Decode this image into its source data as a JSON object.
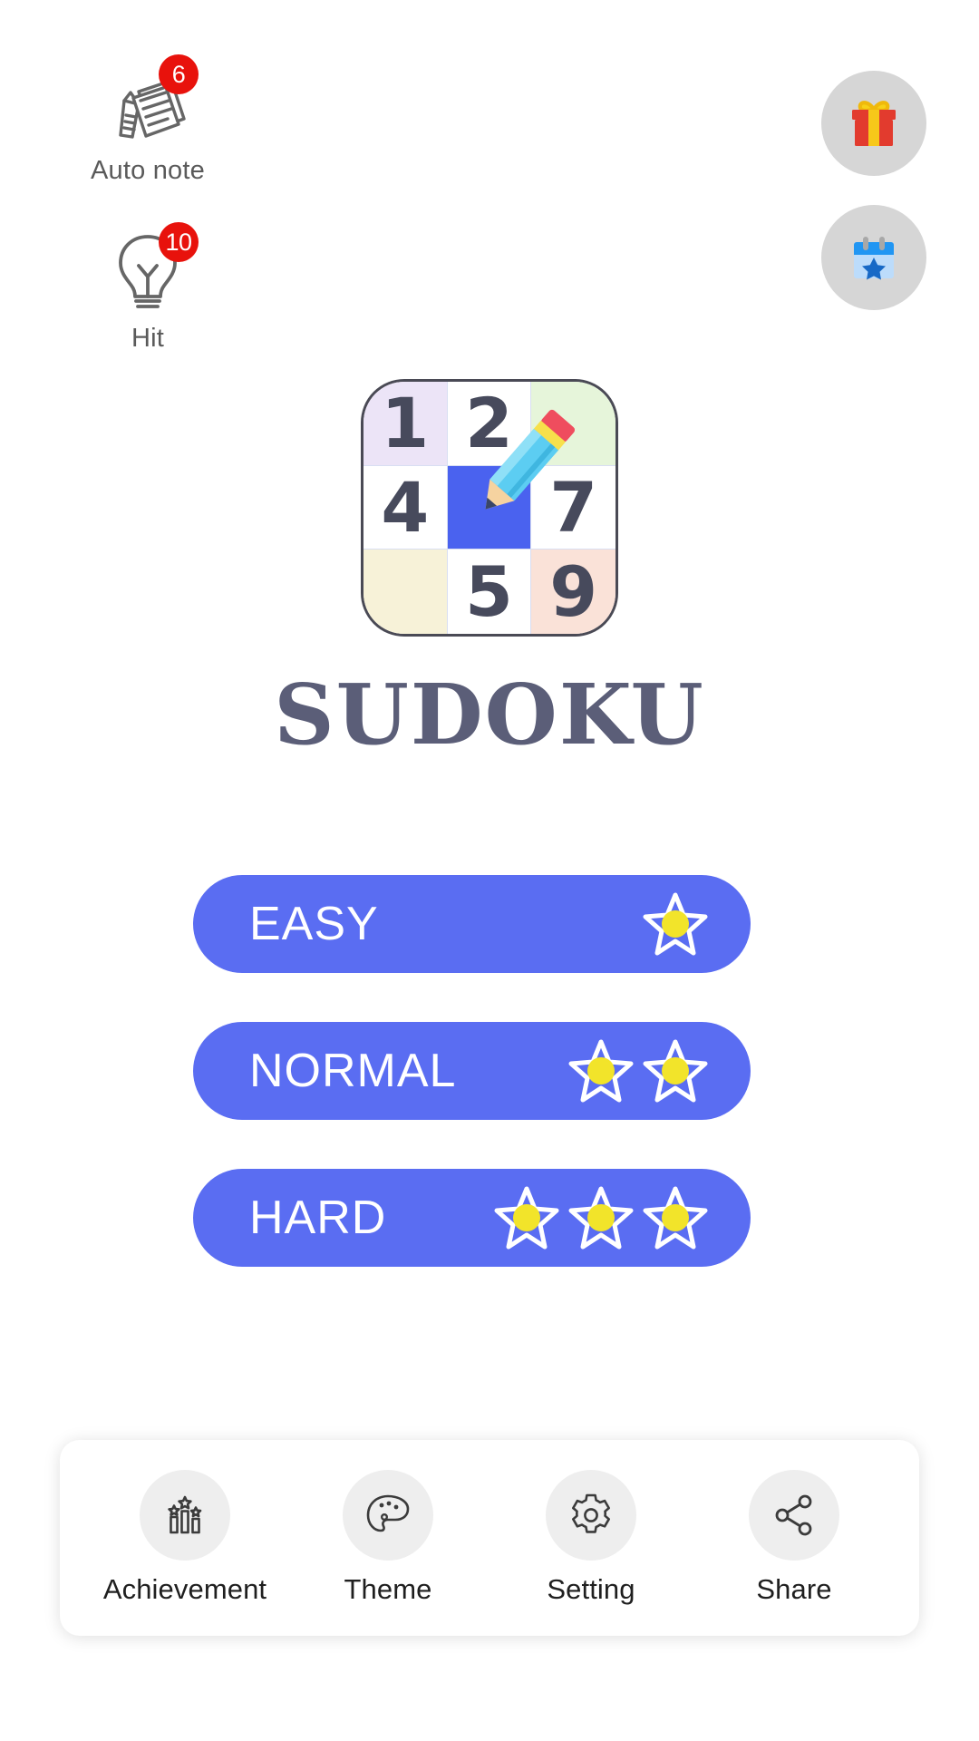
{
  "tools": [
    {
      "id": "auto-note",
      "label": "Auto note",
      "badge": "6",
      "icon": "notes-icon"
    },
    {
      "id": "hit",
      "label": "Hit",
      "badge": "10",
      "icon": "lightbulb-icon"
    }
  ],
  "round_buttons": [
    {
      "id": "gift",
      "icon": "gift-icon"
    },
    {
      "id": "calendar",
      "icon": "calendar-star-icon"
    }
  ],
  "logo": {
    "cells": [
      "1",
      "2",
      "",
      "4",
      "",
      "7",
      "",
      "5",
      "9"
    ],
    "cell_colors": [
      "#ece4f7",
      "#ffffff",
      "#e6f5da",
      "#ffffff",
      "#4a62ef",
      "#ffffff",
      "#f7f2d8",
      "#ffffff",
      "#fae2d8"
    ],
    "selected_index": 4,
    "pencil": "pencil-icon"
  },
  "title": "SUDOKU",
  "difficulties": [
    {
      "label": "EASY",
      "stars": 1
    },
    {
      "label": "NORMAL",
      "stars": 2
    },
    {
      "label": "HARD",
      "stars": 3
    }
  ],
  "bottom_nav": [
    {
      "label": "Achievement",
      "icon": "podium-stars-icon"
    },
    {
      "label": "Theme",
      "icon": "palette-icon"
    },
    {
      "label": "Setting",
      "icon": "gear-icon"
    },
    {
      "label": "Share",
      "icon": "share-icon"
    }
  ],
  "colors": {
    "button_blue": "#5a6df2",
    "star_yellow": "#f2e42a",
    "badge_red": "#e8120c",
    "title_slate": "#5b5e78",
    "circle_gray": "#d6d6d6",
    "nav_circle_gray": "#eeeeee"
  }
}
